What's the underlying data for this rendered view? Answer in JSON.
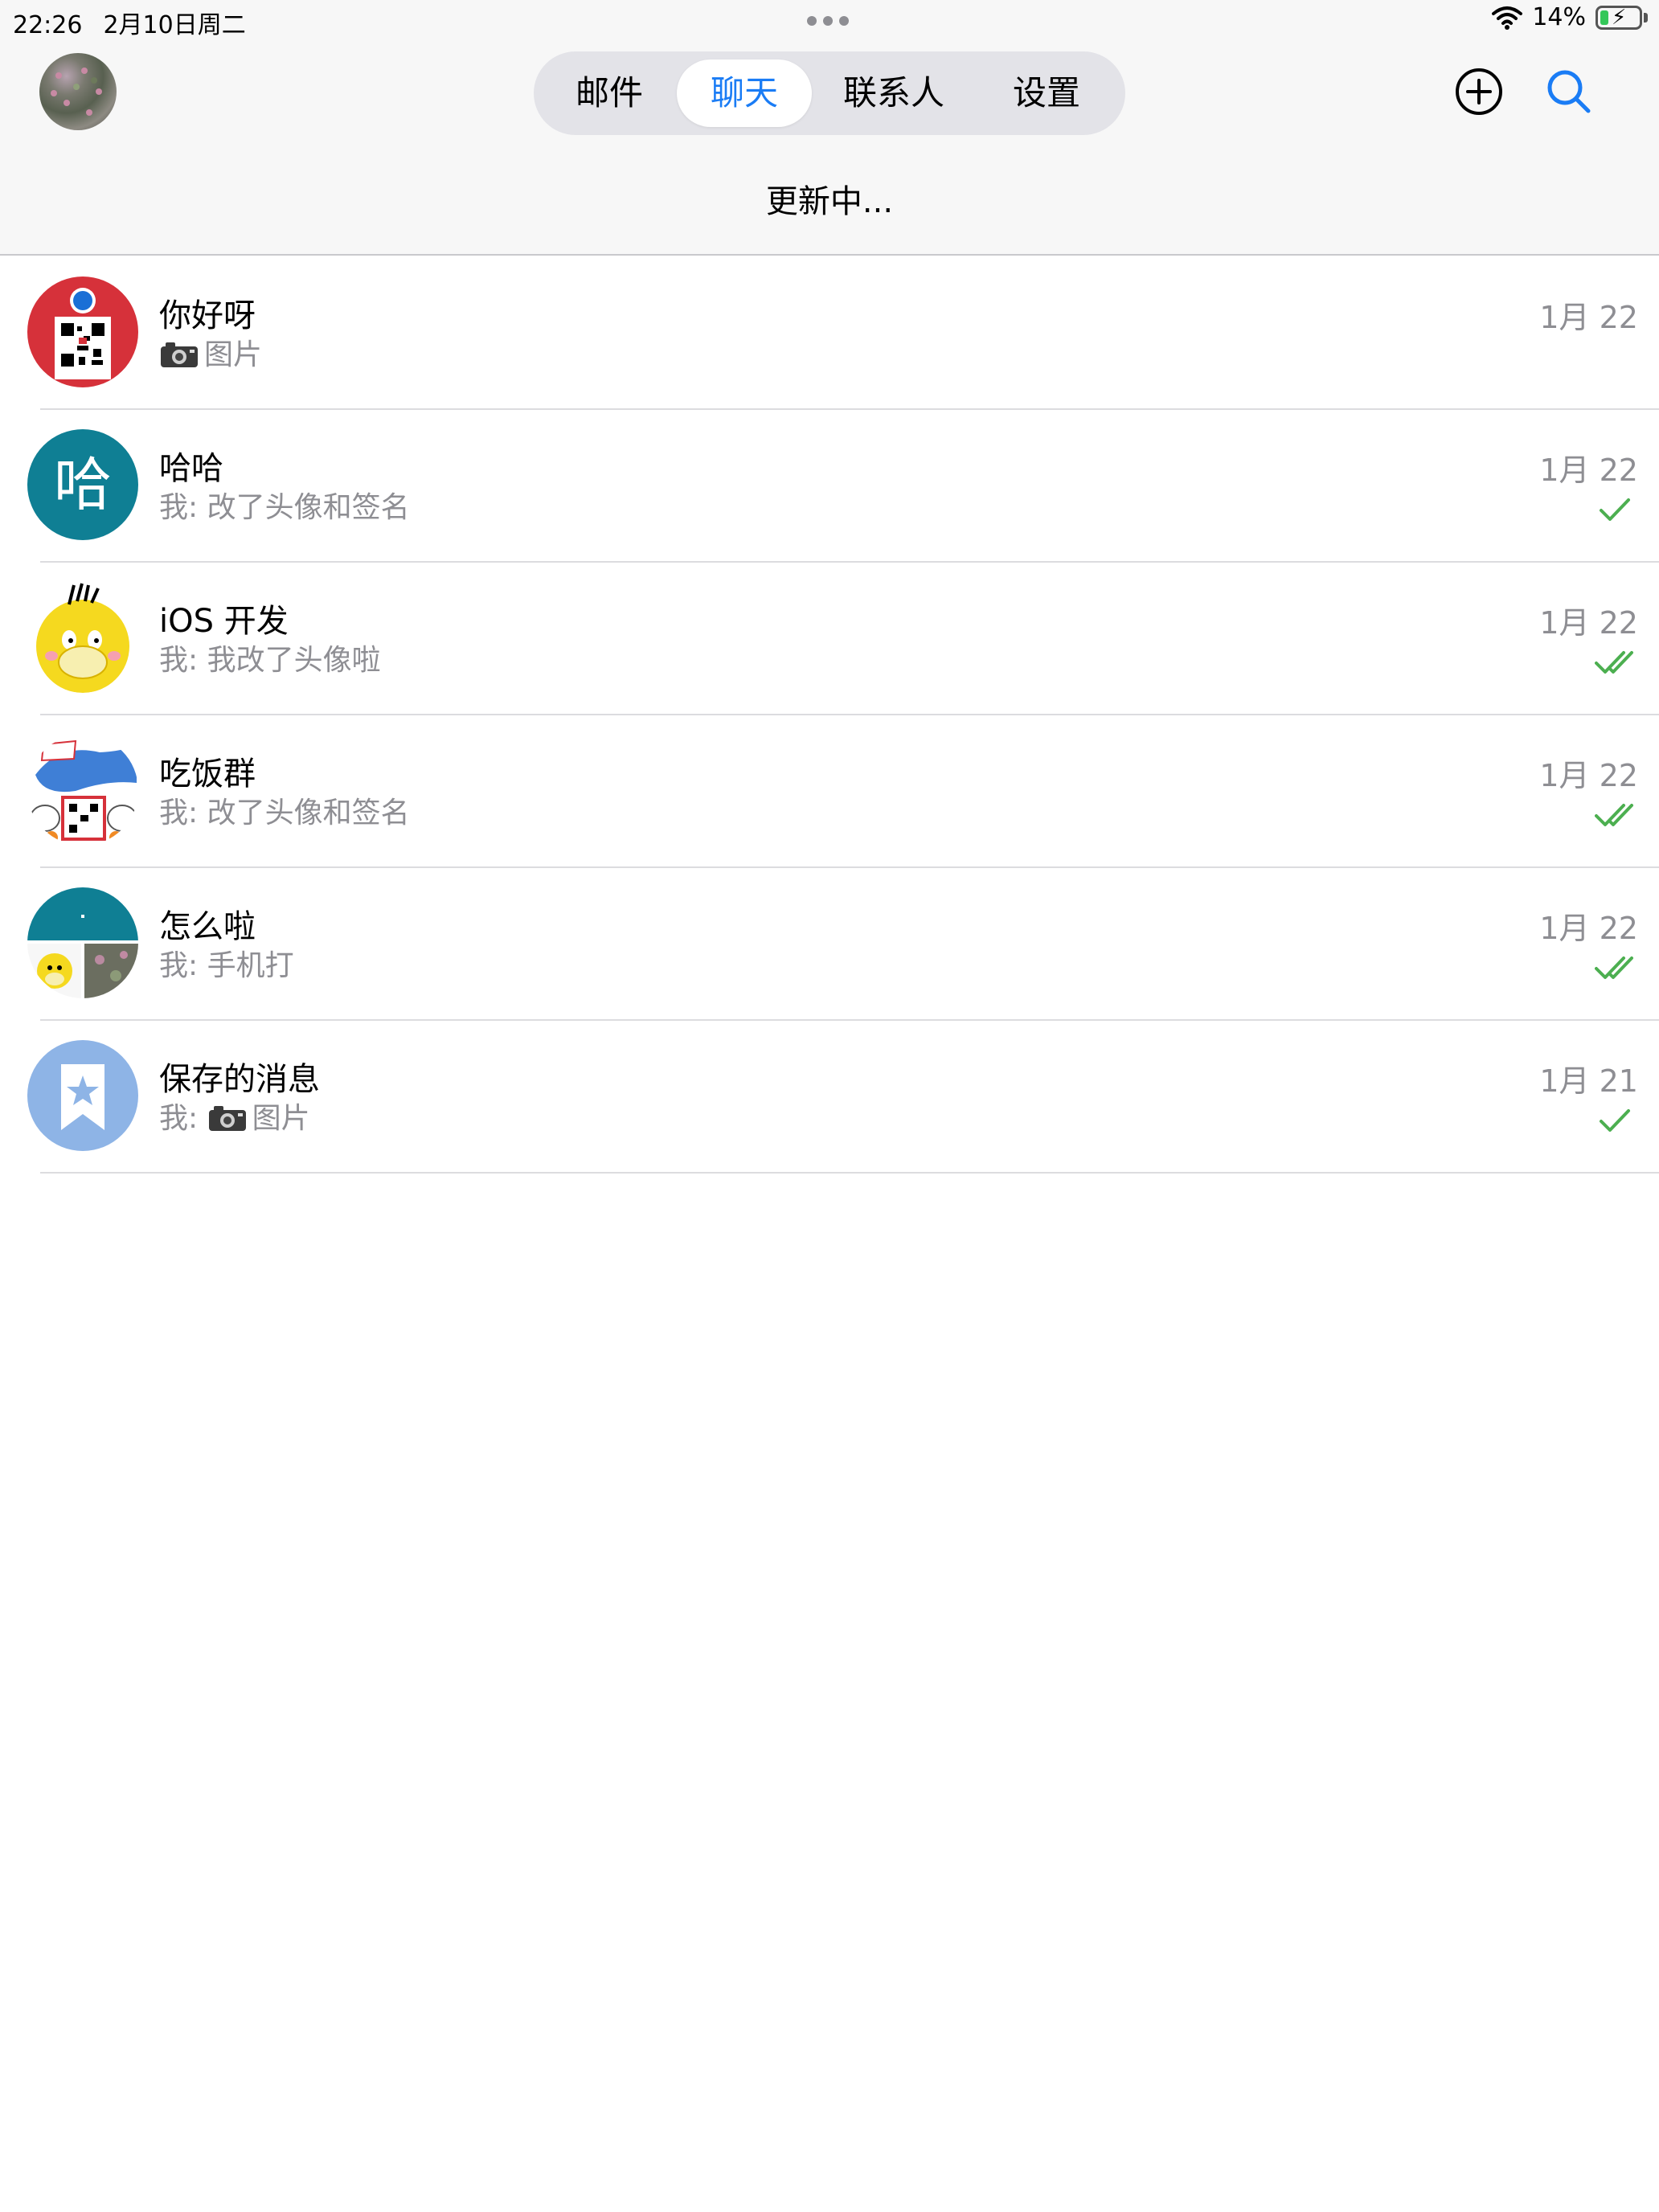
{
  "status_bar": {
    "time": "22:26",
    "date": "2月10日周二",
    "battery": "14%"
  },
  "tabs": [
    {
      "label": "邮件",
      "active": false
    },
    {
      "label": "聊天",
      "active": true
    },
    {
      "label": "联系人",
      "active": false
    },
    {
      "label": "设置",
      "active": false
    }
  ],
  "header": {
    "updating": "更新中..."
  },
  "colors": {
    "accent": "#1a7cf5",
    "check": "#4caf50",
    "secondary_text": "#8e8e93"
  },
  "chats": [
    {
      "title": "你好呀",
      "preview_prefix": "",
      "preview": "图片",
      "has_camera": true,
      "time": "1月 22",
      "status": "none"
    },
    {
      "title": "哈哈",
      "preview_prefix": "我: ",
      "preview": "改了头像和签名",
      "has_camera": false,
      "time": "1月 22",
      "status": "sent",
      "avatar_letter": "哈"
    },
    {
      "title": "iOS 开发",
      "preview_prefix": "我: ",
      "preview": "我改了头像啦",
      "has_camera": false,
      "time": "1月 22",
      "status": "read"
    },
    {
      "title": "吃饭群",
      "preview_prefix": "我: ",
      "preview": "改了头像和签名",
      "has_camera": false,
      "time": "1月 22",
      "status": "read"
    },
    {
      "title": "怎么啦",
      "preview_prefix": "我: ",
      "preview": "手机打",
      "has_camera": false,
      "time": "1月 22",
      "status": "read"
    },
    {
      "title": "保存的消息",
      "preview_prefix": "我: ",
      "preview": "图片",
      "has_camera": true,
      "time": "1月 21",
      "status": "sent"
    }
  ]
}
